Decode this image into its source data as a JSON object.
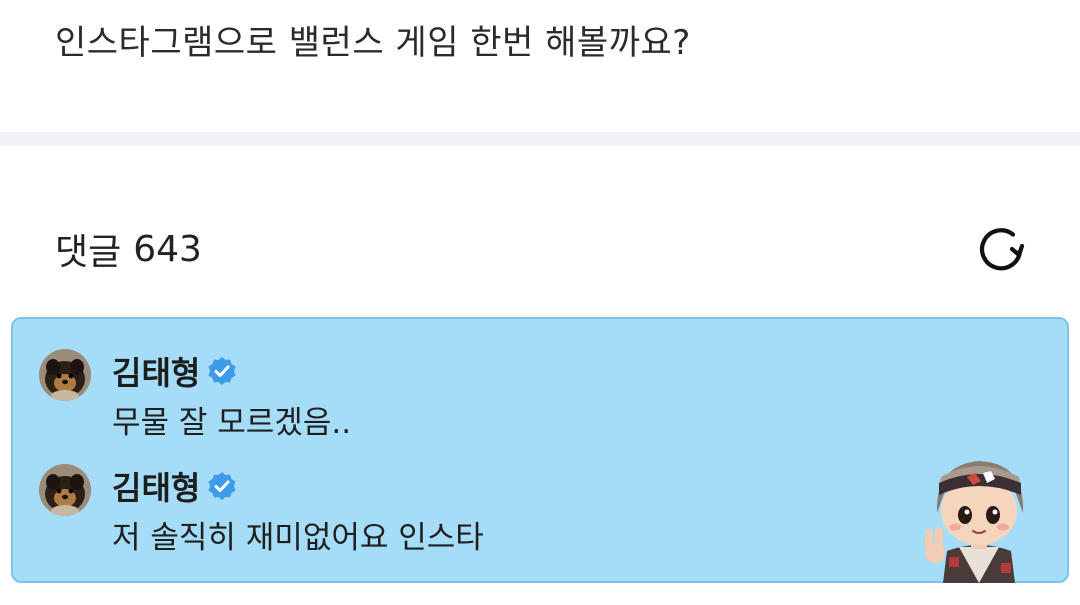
{
  "post": {
    "text": "인스타그램으로 밸런스 게임 한번 해볼까요?"
  },
  "comments_section": {
    "label": "댓글",
    "count": "643",
    "refresh_icon": "refresh-icon"
  },
  "comments": [
    {
      "author": "김태형",
      "badge_icon": "verified-badge-icon",
      "avatar_icon": "dog-avatar",
      "text": "무물 잘 모르겠음.."
    },
    {
      "author": "김태형",
      "badge_icon": "verified-badge-icon",
      "avatar_icon": "dog-avatar",
      "text": "저 솔직히 재미없어요 인스타"
    }
  ],
  "sticker": {
    "icon": "character-sticker"
  },
  "colors": {
    "highlight_bg": "#a5dcf7",
    "highlight_border": "#7cc4e8",
    "verified_blue": "#3d9be9",
    "divider": "#f1f2f5"
  }
}
